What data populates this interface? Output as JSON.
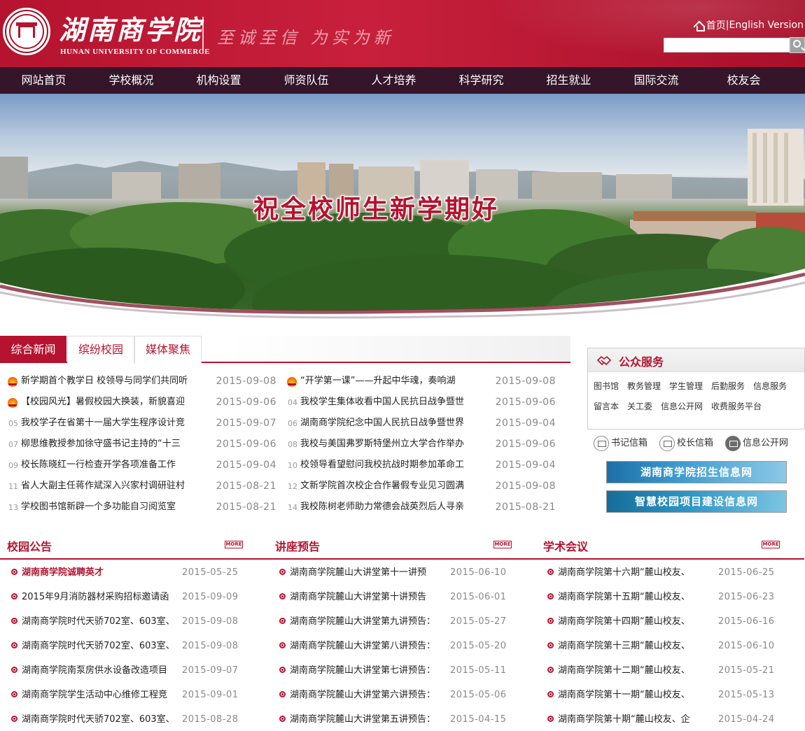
{
  "header": {
    "school_name_cn": "湖南商学院",
    "school_name_en": "HUNAN UNIVERSITY OF COMMERCE",
    "motto": "至诚至信 为实为新",
    "home_link": "首页",
    "separator": "|",
    "english_link": "English Version",
    "search_placeholder": ""
  },
  "nav": {
    "items": [
      "网站首页",
      "学校概况",
      "机构设置",
      "师资队伍",
      "人才培养",
      "科学研究",
      "招生就业",
      "国际交流",
      "校友会"
    ]
  },
  "banner": {
    "slogan": "祝全校师生新学期好"
  },
  "news": {
    "tabs": [
      "综合新闻",
      "缤纷校园",
      "媒体聚焦"
    ],
    "items": [
      {
        "num": "",
        "hot": true,
        "title": "新学期首个教学日 校领导与同学们共同听",
        "date": "2015-09-08"
      },
      {
        "num": "",
        "hot": true,
        "title": "“开学第一课”——升起中华魂，奏响湖",
        "date": "2015-09-08"
      },
      {
        "num": "",
        "hot": true,
        "title": "【校园风光】暑假校园大换装，新貌喜迎",
        "date": "2015-09-06"
      },
      {
        "num": "04",
        "hot": false,
        "title": "我校学生集体收看中国人民抗日战争暨世",
        "date": "2015-09-06"
      },
      {
        "num": "05",
        "hot": false,
        "title": "我校学子在省第十一届大学生程序设计竞",
        "date": "2015-09-07"
      },
      {
        "num": "06",
        "hot": false,
        "title": "湖南商学院纪念中国人民抗日战争暨世界",
        "date": "2015-09-04"
      },
      {
        "num": "07",
        "hot": false,
        "title": "柳思维教授参加徐守盛书记主持的“十三",
        "date": "2015-09-06"
      },
      {
        "num": "08",
        "hot": false,
        "title": "我校与美国弗罗斯特堡州立大学合作举办",
        "date": "2015-09-06"
      },
      {
        "num": "09",
        "hot": false,
        "title": "校长陈晓红一行检查开学各项准备工作",
        "date": "2015-09-04"
      },
      {
        "num": "10",
        "hot": false,
        "title": "校领导看望慰问我校抗战时期参加革命工",
        "date": "2015-09-04"
      },
      {
        "num": "11",
        "hot": false,
        "title": "省人大副主任蒋作斌深入兴家村调研驻村",
        "date": "2015-08-21"
      },
      {
        "num": "12",
        "hot": false,
        "title": "文新学院首次校企合作暑假专业见习圆满",
        "date": "2015-09-08"
      },
      {
        "num": "13",
        "hot": false,
        "title": "学校图书馆新辟一个多功能自习阅览室",
        "date": "2015-08-21"
      },
      {
        "num": "14",
        "hot": false,
        "title": "我校陈树老师助力常德会战英烈后人寻亲",
        "date": "2015-08-21"
      }
    ]
  },
  "services": {
    "title": "公众服务",
    "links": [
      "图书馆",
      "教务管理",
      "学生管理",
      "后勤服务",
      "信息服务",
      "留言本",
      "关工委",
      "信息公开网",
      "收费服务平台"
    ]
  },
  "mailboxes": [
    "书记信箱",
    "校长信箱",
    "信息公开网"
  ],
  "banner_links": [
    "湖南商学院招生信息网",
    "智慧校园项目建设信息网"
  ],
  "columns": [
    {
      "title": "校园公告",
      "more": "MORE",
      "items": [
        {
          "title": "湖南商学院诚聘英才",
          "date": "2015-05-25",
          "highlight": true
        },
        {
          "title": "2015年9月消防器材采购招标邀请函",
          "date": "2015-09-09",
          "highlight": false
        },
        {
          "title": "湖南商学院时代天骄702室、603室、",
          "date": "2015-09-08",
          "highlight": false
        },
        {
          "title": "湖南商学院时代天骄702室、603室、",
          "date": "2015-09-08",
          "highlight": false
        },
        {
          "title": "湖南商学院南泵房供水设备改造项目",
          "date": "2015-09-07",
          "highlight": false
        },
        {
          "title": "湖南商学院学生活动中心维修工程竞",
          "date": "2015-09-01",
          "highlight": false
        },
        {
          "title": "湖南商学院时代天骄702室、603室、",
          "date": "2015-08-28",
          "highlight": false
        }
      ]
    },
    {
      "title": "讲座预告",
      "more": "MORE",
      "items": [
        {
          "title": "湖南商学院麓山大讲堂第十一讲预",
          "date": "2015-06-10",
          "highlight": false
        },
        {
          "title": "湖南商学院麓山大讲堂第十讲预告",
          "date": "2015-06-01",
          "highlight": false
        },
        {
          "title": "湖南商学院麓山大讲堂第九讲预告：",
          "date": "2015-05-27",
          "highlight": false
        },
        {
          "title": "湖南商学院麓山大讲堂第八讲预告：",
          "date": "2015-05-20",
          "highlight": false
        },
        {
          "title": "湖南商学院麓山大讲堂第七讲预告：",
          "date": "2015-05-11",
          "highlight": false
        },
        {
          "title": "湖南商学院麓山大讲堂第六讲预告：",
          "date": "2015-05-06",
          "highlight": false
        },
        {
          "title": "湖南商学院麓山大讲堂第五讲预告：",
          "date": "2015-04-15",
          "highlight": false
        }
      ]
    },
    {
      "title": "学术会议",
      "more": "MORE",
      "items": [
        {
          "title": "湖南商学院第十六期“麓山校友、",
          "date": "2015-06-25",
          "highlight": false
        },
        {
          "title": "湖南商学院第十五期“麓山校友、",
          "date": "2015-06-23",
          "highlight": false
        },
        {
          "title": "湖南商学院第十四期“麓山校友、",
          "date": "2015-06-16",
          "highlight": false
        },
        {
          "title": "湖南商学院第十三期“麓山校友、",
          "date": "2015-06-10",
          "highlight": false
        },
        {
          "title": "湖南商学院第十二期“麓山校友、",
          "date": "2015-05-21",
          "highlight": false
        },
        {
          "title": "湖南商学院第十一期“麓山校友、",
          "date": "2015-05-13",
          "highlight": false
        },
        {
          "title": "湖南商学院第十期“麓山校友、企",
          "date": "2015-04-24",
          "highlight": false
        }
      ]
    }
  ]
}
